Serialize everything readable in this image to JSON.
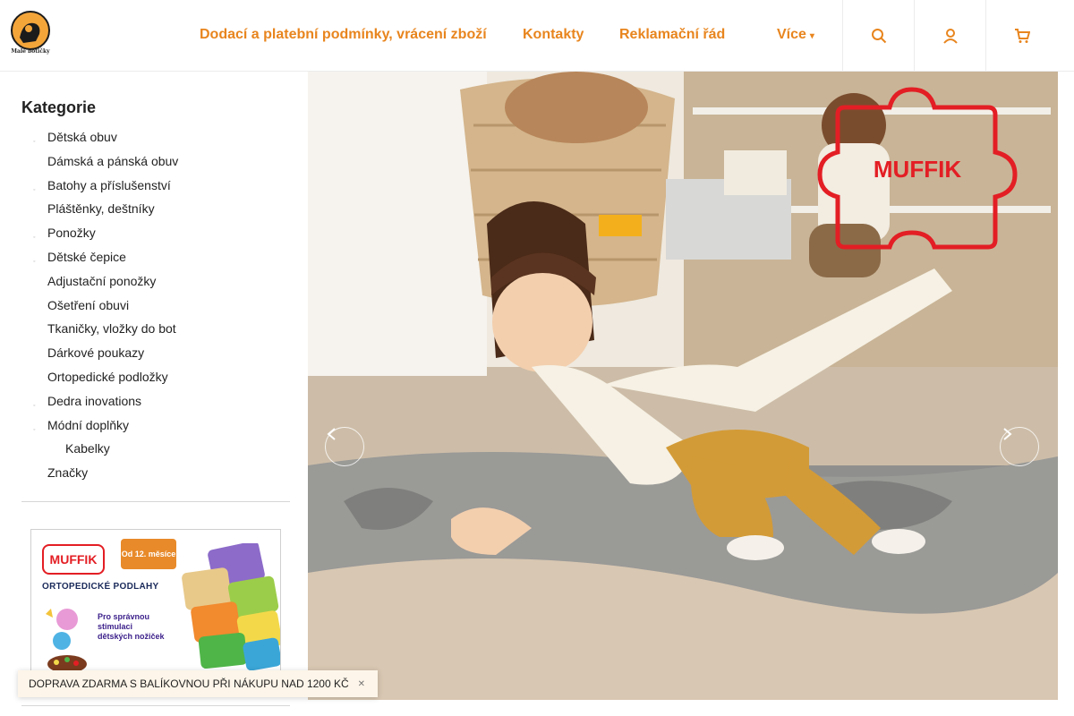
{
  "header": {
    "logo_text": "Malé botičky",
    "nav": [
      {
        "label": "Dodací a platební podmínky, vrácení zboží"
      },
      {
        "label": "Kontakty"
      },
      {
        "label": "Reklamační řád"
      },
      {
        "label": "Více"
      }
    ],
    "icons": [
      "search-icon",
      "user-icon",
      "cart-icon"
    ]
  },
  "sidebar": {
    "title": "Kategorie",
    "items": [
      {
        "label": "Dětská obuv",
        "bullet": true
      },
      {
        "label": "Dámská a pánská obuv",
        "bullet": false
      },
      {
        "label": "Batohy a příslušenství",
        "bullet": true
      },
      {
        "label": "Pláštěnky, deštníky",
        "bullet": false
      },
      {
        "label": "Ponožky",
        "bullet": true
      },
      {
        "label": "Dětské čepice",
        "bullet": true
      },
      {
        "label": "Adjustační ponožky",
        "bullet": false
      },
      {
        "label": "Ošetření obuvi",
        "bullet": false
      },
      {
        "label": "Tkaničky, vložky do bot",
        "bullet": false
      },
      {
        "label": "Dárkové poukazy",
        "bullet": false
      },
      {
        "label": "Ortopedické podložky",
        "bullet": false
      },
      {
        "label": "Dedra inovations",
        "bullet": true
      },
      {
        "label": "Módní doplňky",
        "bullet": true
      },
      {
        "label": "Kabelky",
        "bullet": false,
        "sub": true
      },
      {
        "label": "Značky",
        "bullet": false
      }
    ]
  },
  "banner": {
    "brand": "MUFFIK",
    "badge": "Od 12. měsíce",
    "title": "ORTOPEDICKÉ PODLAHY",
    "text": "Pro správnou stimulaci dětských nožiček"
  },
  "hero": {
    "logo_text": "MUFFIK"
  },
  "shipping_bar": {
    "text": "DOPRAVA ZDARMA S BALÍKOVNOU PŘI NÁKUPU NAD 1200 KČ"
  },
  "colors": {
    "accent": "#e8851e",
    "brand_red": "#e31e24"
  }
}
